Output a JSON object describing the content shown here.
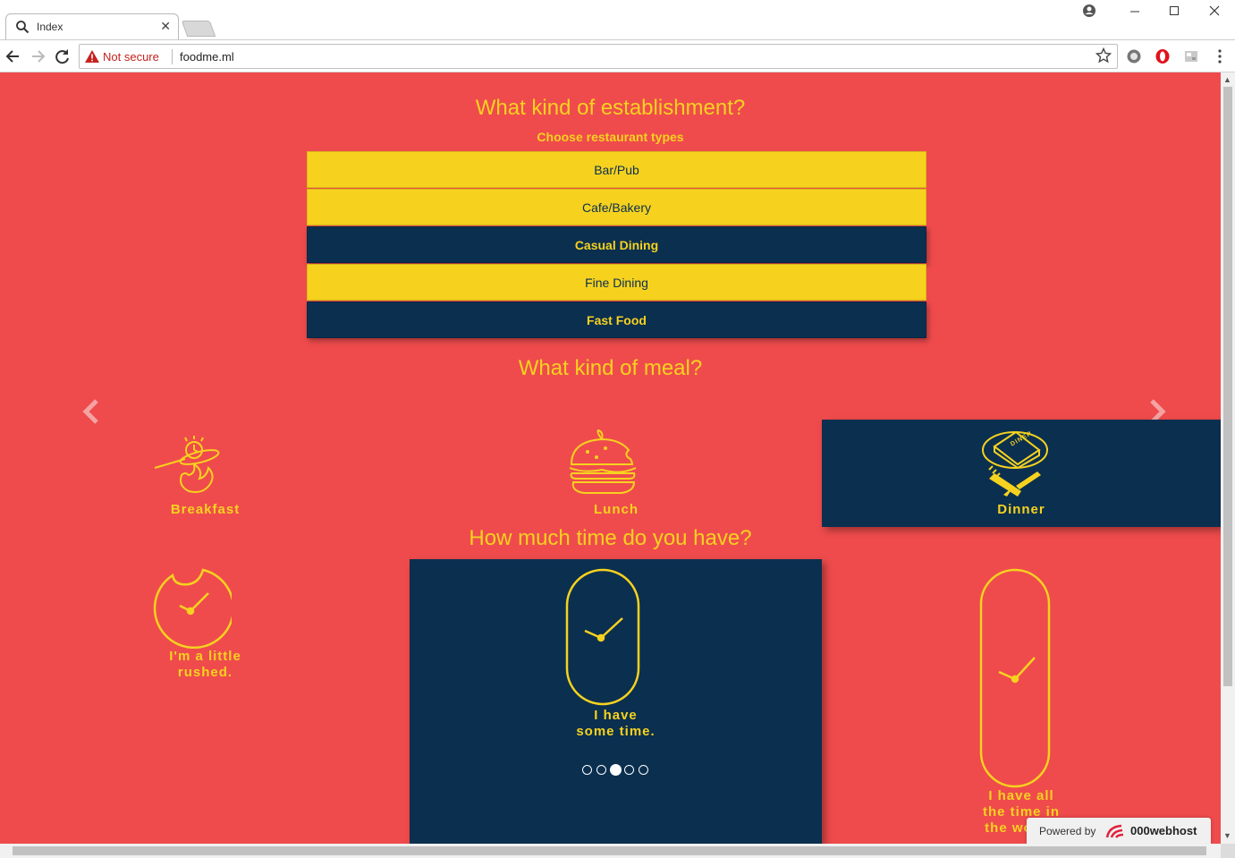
{
  "browser": {
    "tab_title": "Index",
    "tab_close": "✕",
    "security_label": "Not secure",
    "url": "foodme.ml"
  },
  "page": {
    "establishment_heading": "What kind of establishment?",
    "establishment_sub": "Choose restaurant types",
    "types": [
      {
        "label": "Bar/Pub",
        "selected": false
      },
      {
        "label": "Cafe/Bakery",
        "selected": false
      },
      {
        "label": "Casual Dining",
        "selected": true
      },
      {
        "label": "Fine Dining",
        "selected": false
      },
      {
        "label": "Fast Food",
        "selected": true
      }
    ],
    "meal_heading": "What kind of meal?",
    "meals": [
      {
        "label": "Breakfast",
        "icon": "breakfast-icon",
        "selected": false
      },
      {
        "label": "Lunch",
        "icon": "burger-icon",
        "selected": false
      },
      {
        "label": "Dinner",
        "icon": "dinner-icon",
        "selected": true
      }
    ],
    "time_heading": "How much time do you have?",
    "times": [
      {
        "line1": "I'm a little",
        "line2": "rushed.",
        "icon": "short-clock-icon",
        "selected": false
      },
      {
        "line1": "I have",
        "line2": "some time.",
        "icon": "medium-clock-icon",
        "selected": true
      },
      {
        "line1": "I have all",
        "line2": "the time in",
        "line3": "the world!",
        "icon": "long-clock-icon",
        "selected": false
      }
    ],
    "pagination": {
      "count": 5,
      "active_index": 3
    }
  },
  "footer": {
    "powered_by": "Powered by",
    "brand": "000webhost"
  },
  "colors": {
    "page_bg": "#ef4b4c",
    "accent_yellow": "#f6d21f",
    "navy": "#0b2f4f"
  }
}
